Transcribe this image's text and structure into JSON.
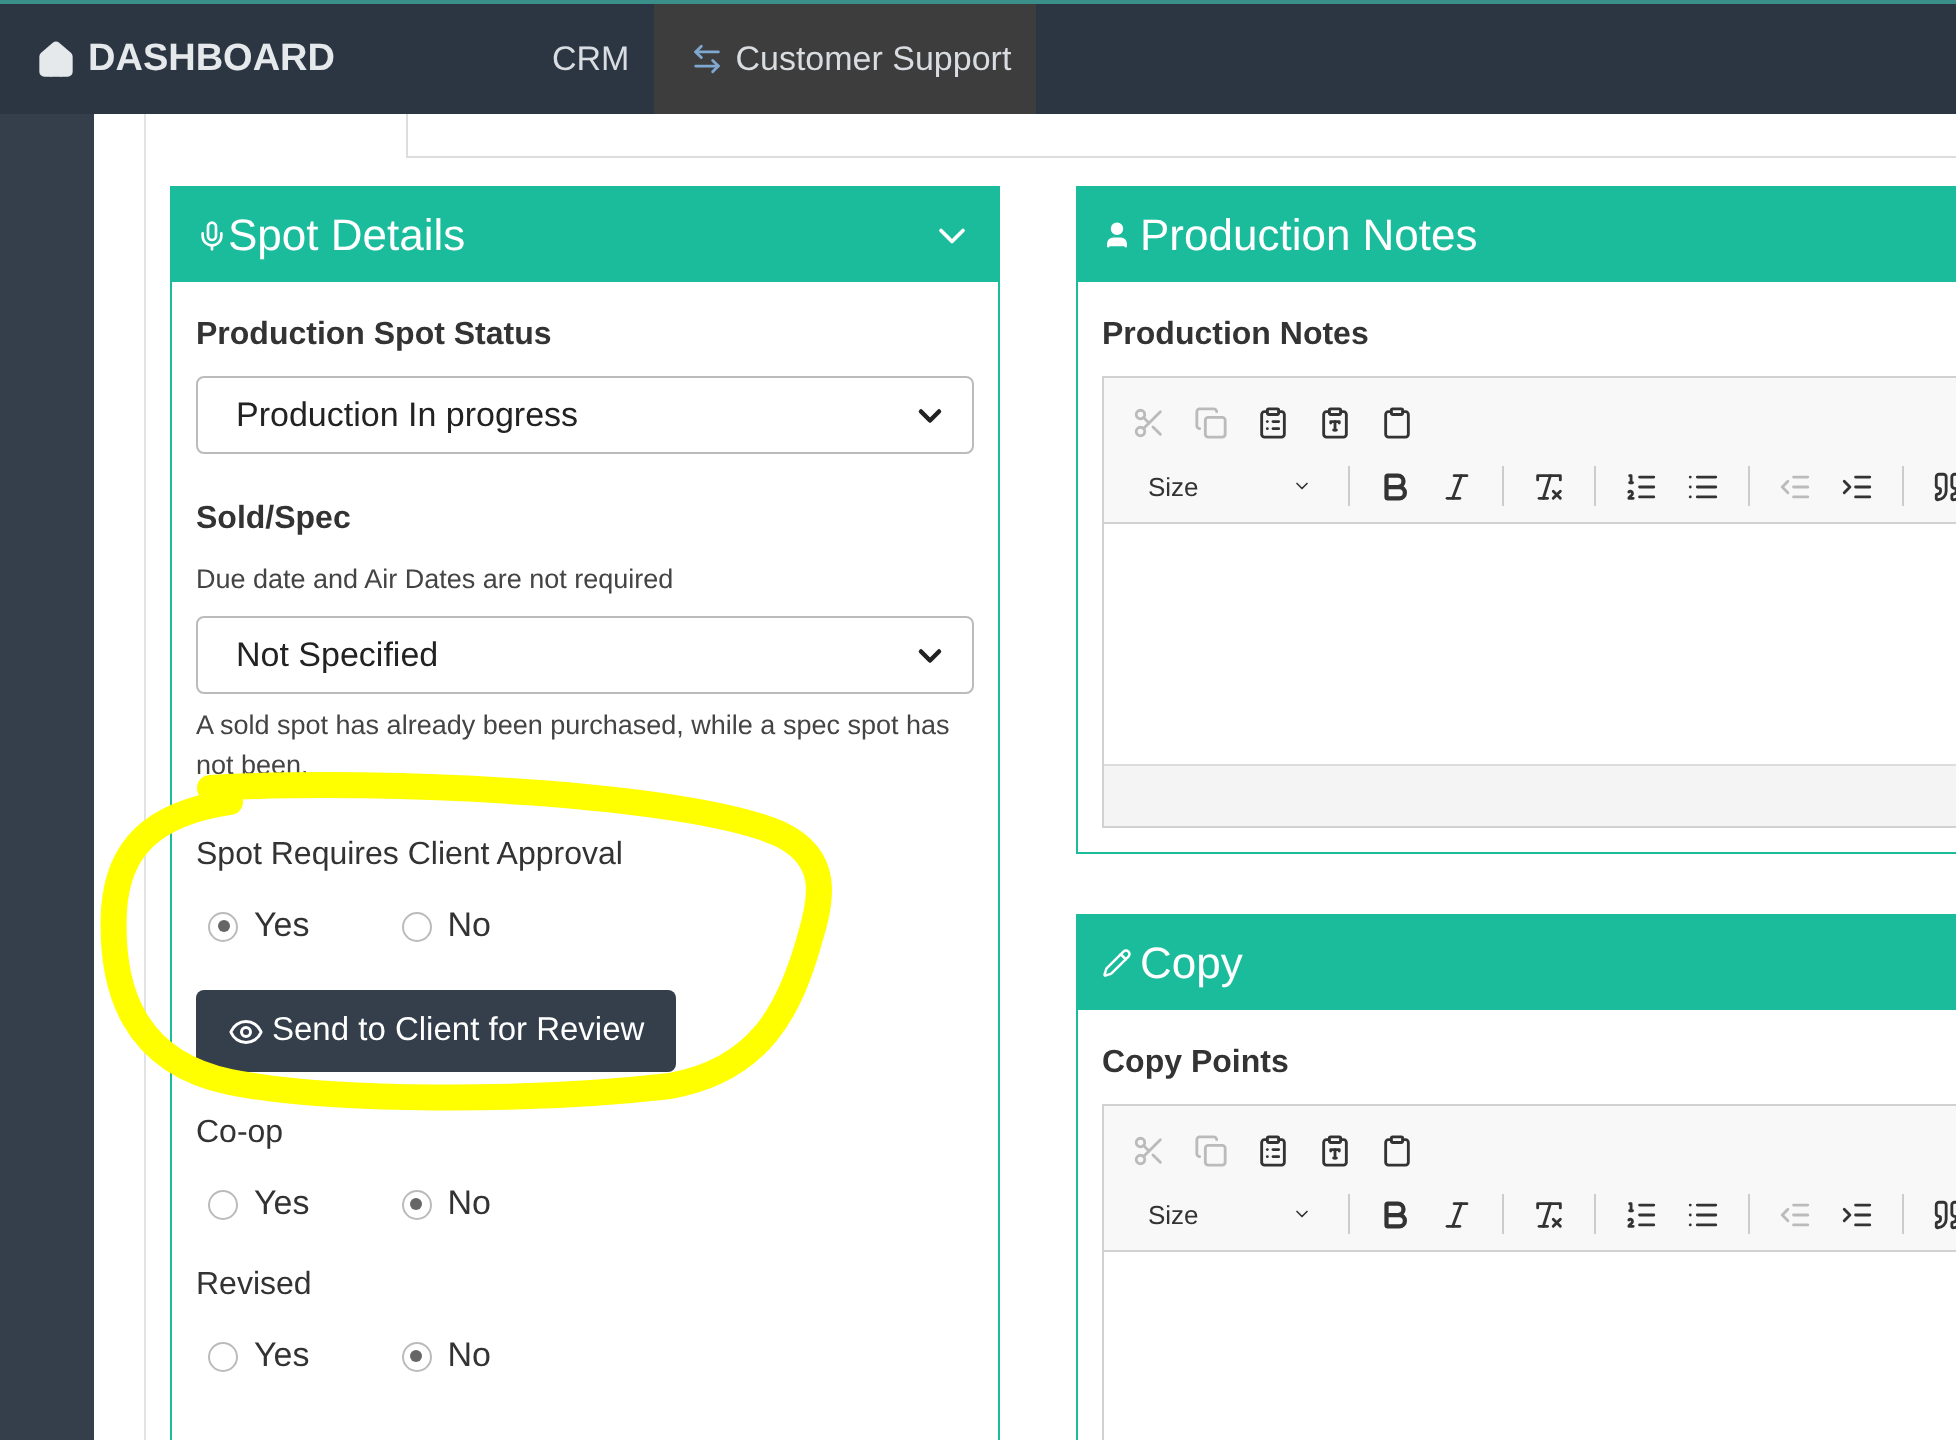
{
  "nav": {
    "brand": "DASHBOARD",
    "items": [
      {
        "label": "CRM",
        "selected": false
      },
      {
        "label": "Customer Support",
        "selected": true
      }
    ]
  },
  "spot_details": {
    "title": "Spot Details",
    "fields": [
      {
        "kind": "select",
        "label": "Production Spot Status",
        "value": "Production In progress"
      },
      {
        "kind": "select",
        "label": "Sold/Spec",
        "help_above": "Due date and Air Dates are not required",
        "value": "Not Specified",
        "help_below": "A sold spot has already been purchased, while a spec spot has not been."
      },
      {
        "kind": "radio",
        "label": "Spot Requires Client Approval",
        "options": [
          {
            "label": "Yes",
            "selected": true
          },
          {
            "label": "No",
            "selected": false
          }
        ]
      },
      {
        "kind": "button",
        "label": "Send to Client for Review"
      },
      {
        "kind": "radio",
        "label": "Co-op",
        "options": [
          {
            "label": "Yes",
            "selected": false
          },
          {
            "label": "No",
            "selected": true
          }
        ]
      },
      {
        "kind": "radio",
        "label": "Revised",
        "options": [
          {
            "label": "Yes",
            "selected": false
          },
          {
            "label": "No",
            "selected": true
          }
        ]
      }
    ]
  },
  "side_panels": [
    {
      "kind": "notes",
      "title": "Production Notes",
      "field_label": "Production Notes",
      "size_label": "Size",
      "tools": [
        {
          "kind": "cut",
          "disabled": true
        },
        {
          "kind": "copy",
          "disabled": true
        },
        {
          "kind": "paste",
          "disabled": false
        },
        {
          "kind": "paste-text",
          "disabled": false
        },
        {
          "kind": "paste-word",
          "disabled": false
        }
      ],
      "format_tools": [
        {
          "kind": "bold",
          "disabled": false
        },
        {
          "kind": "italic",
          "disabled": false
        },
        {
          "kind": "clear",
          "disabled": false
        },
        {
          "kind": "ordered",
          "disabled": false
        },
        {
          "kind": "bullets",
          "disabled": false
        },
        {
          "kind": "outdent",
          "disabled": true
        },
        {
          "kind": "indent",
          "disabled": false
        },
        {
          "kind": "quote",
          "disabled": false
        }
      ]
    },
    {
      "kind": "copy",
      "title": "Copy",
      "field_label": "Copy Points",
      "size_label": "Size",
      "tools": [
        {
          "kind": "cut",
          "disabled": true
        },
        {
          "kind": "copy",
          "disabled": true
        },
        {
          "kind": "paste",
          "disabled": false
        },
        {
          "kind": "paste-text",
          "disabled": false
        },
        {
          "kind": "paste-word",
          "disabled": false
        }
      ],
      "format_tools": [
        {
          "kind": "bold",
          "disabled": false
        },
        {
          "kind": "italic",
          "disabled": false
        },
        {
          "kind": "clear",
          "disabled": false
        },
        {
          "kind": "ordered",
          "disabled": false
        },
        {
          "kind": "bullets",
          "disabled": false
        },
        {
          "kind": "outdent",
          "disabled": true
        },
        {
          "kind": "indent",
          "disabled": false
        },
        {
          "kind": "quote",
          "disabled": false
        }
      ]
    }
  ]
}
